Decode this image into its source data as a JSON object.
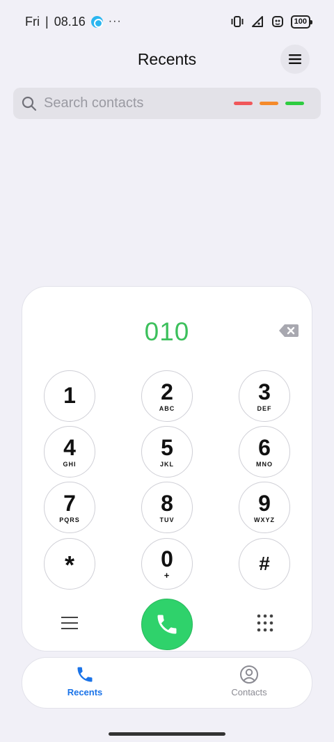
{
  "status_bar": {
    "day": "Fri",
    "time": "08.16",
    "separator": "|",
    "more": "···",
    "battery": "100"
  },
  "header": {
    "title": "Recents"
  },
  "search": {
    "placeholder": "Search contacts",
    "dash_colors": [
      "#f0575a",
      "#f58a2a",
      "#2ecc40"
    ]
  },
  "dialer": {
    "number": "010",
    "keys": [
      {
        "digit": "1",
        "letters": ""
      },
      {
        "digit": "2",
        "letters": "ABC"
      },
      {
        "digit": "3",
        "letters": "DEF"
      },
      {
        "digit": "4",
        "letters": "GHI"
      },
      {
        "digit": "5",
        "letters": "JKL"
      },
      {
        "digit": "6",
        "letters": "MNO"
      },
      {
        "digit": "7",
        "letters": "PQRS"
      },
      {
        "digit": "8",
        "letters": "TUV"
      },
      {
        "digit": "9",
        "letters": "WXYZ"
      },
      {
        "digit": "*",
        "letters": ""
      },
      {
        "digit": "0",
        "letters": "+"
      },
      {
        "digit": "#",
        "letters": ""
      }
    ]
  },
  "tabs": [
    {
      "label": "Recents",
      "active": true
    },
    {
      "label": "Contacts",
      "active": false
    }
  ],
  "colors": {
    "accent": "#1a73e8",
    "call": "#2fd26b",
    "number": "#3cc05c"
  }
}
